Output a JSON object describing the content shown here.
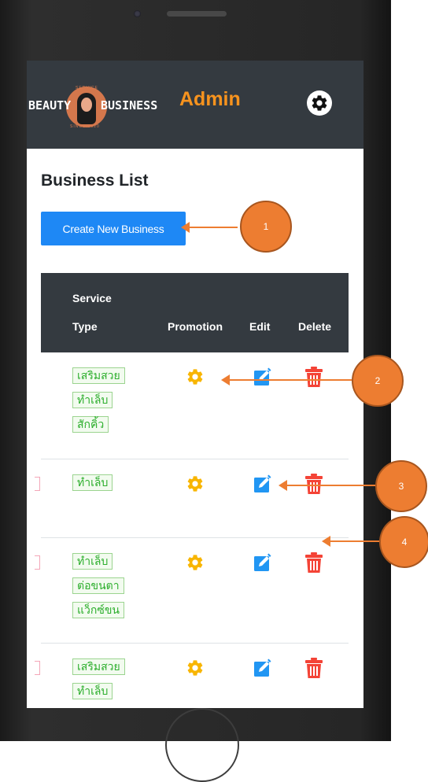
{
  "brand": {
    "logo_left": "BEAUTY",
    "logo_right": "BUSINESS",
    "logo_service": "SERVICE",
    "logo_since": "SINCE 2020",
    "admin_label": "Admin"
  },
  "page": {
    "title": "Business List",
    "create_button": "Create New Business"
  },
  "table": {
    "headers": {
      "service": "Service",
      "type": "Type",
      "promotion": "Promotion",
      "edit": "Edit",
      "delete": "Delete"
    },
    "rows": [
      {
        "types": [
          "เสริมสวย",
          "ทำเล็บ",
          "สักคิ้ว"
        ]
      },
      {
        "types": [
          "ทำเล็บ"
        ]
      },
      {
        "types": [
          "ทำเล็บ",
          "ต่อขนตา",
          "แว็กซ์ขน"
        ]
      },
      {
        "types": [
          "เสริมสวย",
          "ทำเล็บ"
        ]
      }
    ]
  },
  "callouts": [
    "1",
    "2",
    "3",
    "4"
  ],
  "icons": {
    "settings": "gear-icon",
    "promotion": "gear-icon",
    "edit": "edit-icon",
    "delete": "trash-icon"
  },
  "colors": {
    "navbar": "#343a40",
    "admin_text": "#f7931e",
    "primary_button": "#1e88f5",
    "tag_text": "#2cae2c",
    "promo_icon": "#f8b500",
    "edit_icon": "#2196f3",
    "delete_icon": "#f44336",
    "callout": "#ed7d31"
  }
}
